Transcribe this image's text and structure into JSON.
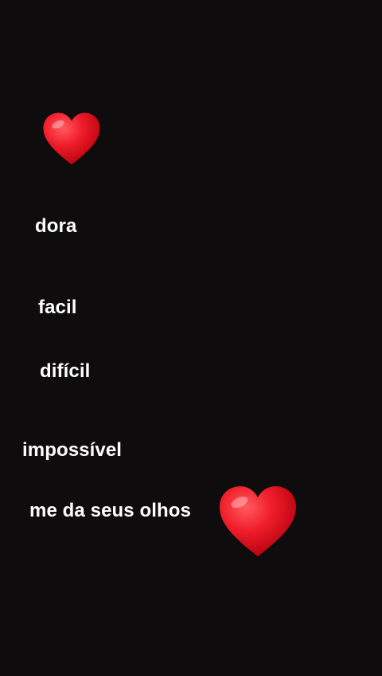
{
  "story": {
    "background_color": "#0e0c0c",
    "text_color": "#ffffff",
    "stickers": [
      {
        "icon": "red-heart-emoji",
        "color": "#e8101e"
      },
      {
        "icon": "red-heart-emoji",
        "color": "#e8101e"
      }
    ],
    "captions": {
      "line1": "dora",
      "line2": "facil",
      "line3": "difícil",
      "line4": "impossível",
      "line5": "me da seus olhos"
    }
  }
}
